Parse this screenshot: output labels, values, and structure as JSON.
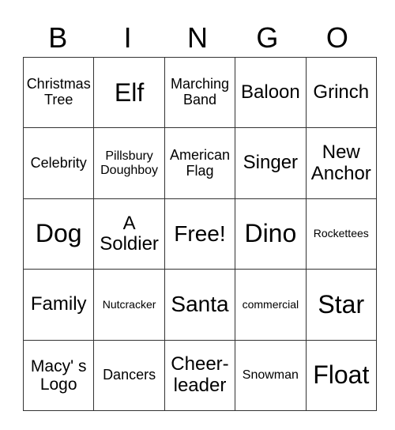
{
  "header": [
    "B",
    "I",
    "N",
    "G",
    "O"
  ],
  "cells": [
    [
      "Christmas Tree",
      "Elf",
      "Marching Band",
      "Baloon",
      "Grinch"
    ],
    [
      "Celebrity",
      "Pillsbury Doughboy",
      "American Flag",
      "Singer",
      "New Anchor"
    ],
    [
      "Dog",
      "A Soldier",
      "Free!",
      "Dino",
      "Rockettees"
    ],
    [
      "Family",
      "Nutcracker",
      "Santa",
      "commercial",
      "Star"
    ],
    [
      "Macy' s Logo",
      "Dancers",
      "Cheer-leader",
      "Snowman",
      "Float"
    ]
  ]
}
